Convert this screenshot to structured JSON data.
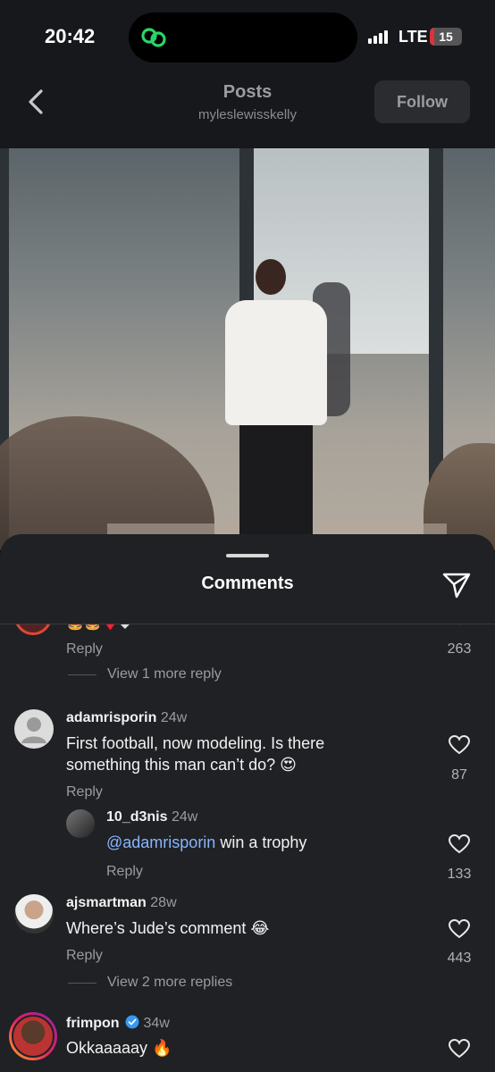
{
  "status": {
    "time": "20:42",
    "network": "LTE",
    "battery": "15",
    "battery_level": 0.15
  },
  "header": {
    "title": "Posts",
    "subtitle": "myleslewisskelly",
    "follow_label": "Follow"
  },
  "comments_panel": {
    "title": "Comments"
  },
  "comments": {
    "prev": {
      "emoji": "🍔🍔♦️◆",
      "reply_label": "Reply",
      "count": "263",
      "view_more": "View 1 more reply"
    },
    "c1": {
      "username": "adamrisporin",
      "age": "24w",
      "text": "First football, now modeling. Is there something this man can’t do? 😍",
      "count": "87",
      "reply_label": "Reply"
    },
    "c1_reply": {
      "username": "10_d3nis",
      "age": "24w",
      "mention": "@adamrisporin",
      "text": " win a trophy",
      "count": "133",
      "reply_label": "Reply"
    },
    "c2": {
      "username": "ajsmartman",
      "age": "28w",
      "text": "Where’s Jude’s comment 😂",
      "count": "443",
      "reply_label": "Reply",
      "view_more": "View 2 more replies"
    },
    "c3": {
      "username": "frimpon",
      "age": "34w",
      "text": "Okkaaaaay 🔥"
    }
  },
  "colors": {
    "link_blue": "#8ab4ff",
    "verified": "#3897f0",
    "follow_bg": "#2a2c30",
    "sheet_bg": "#1f2124"
  }
}
